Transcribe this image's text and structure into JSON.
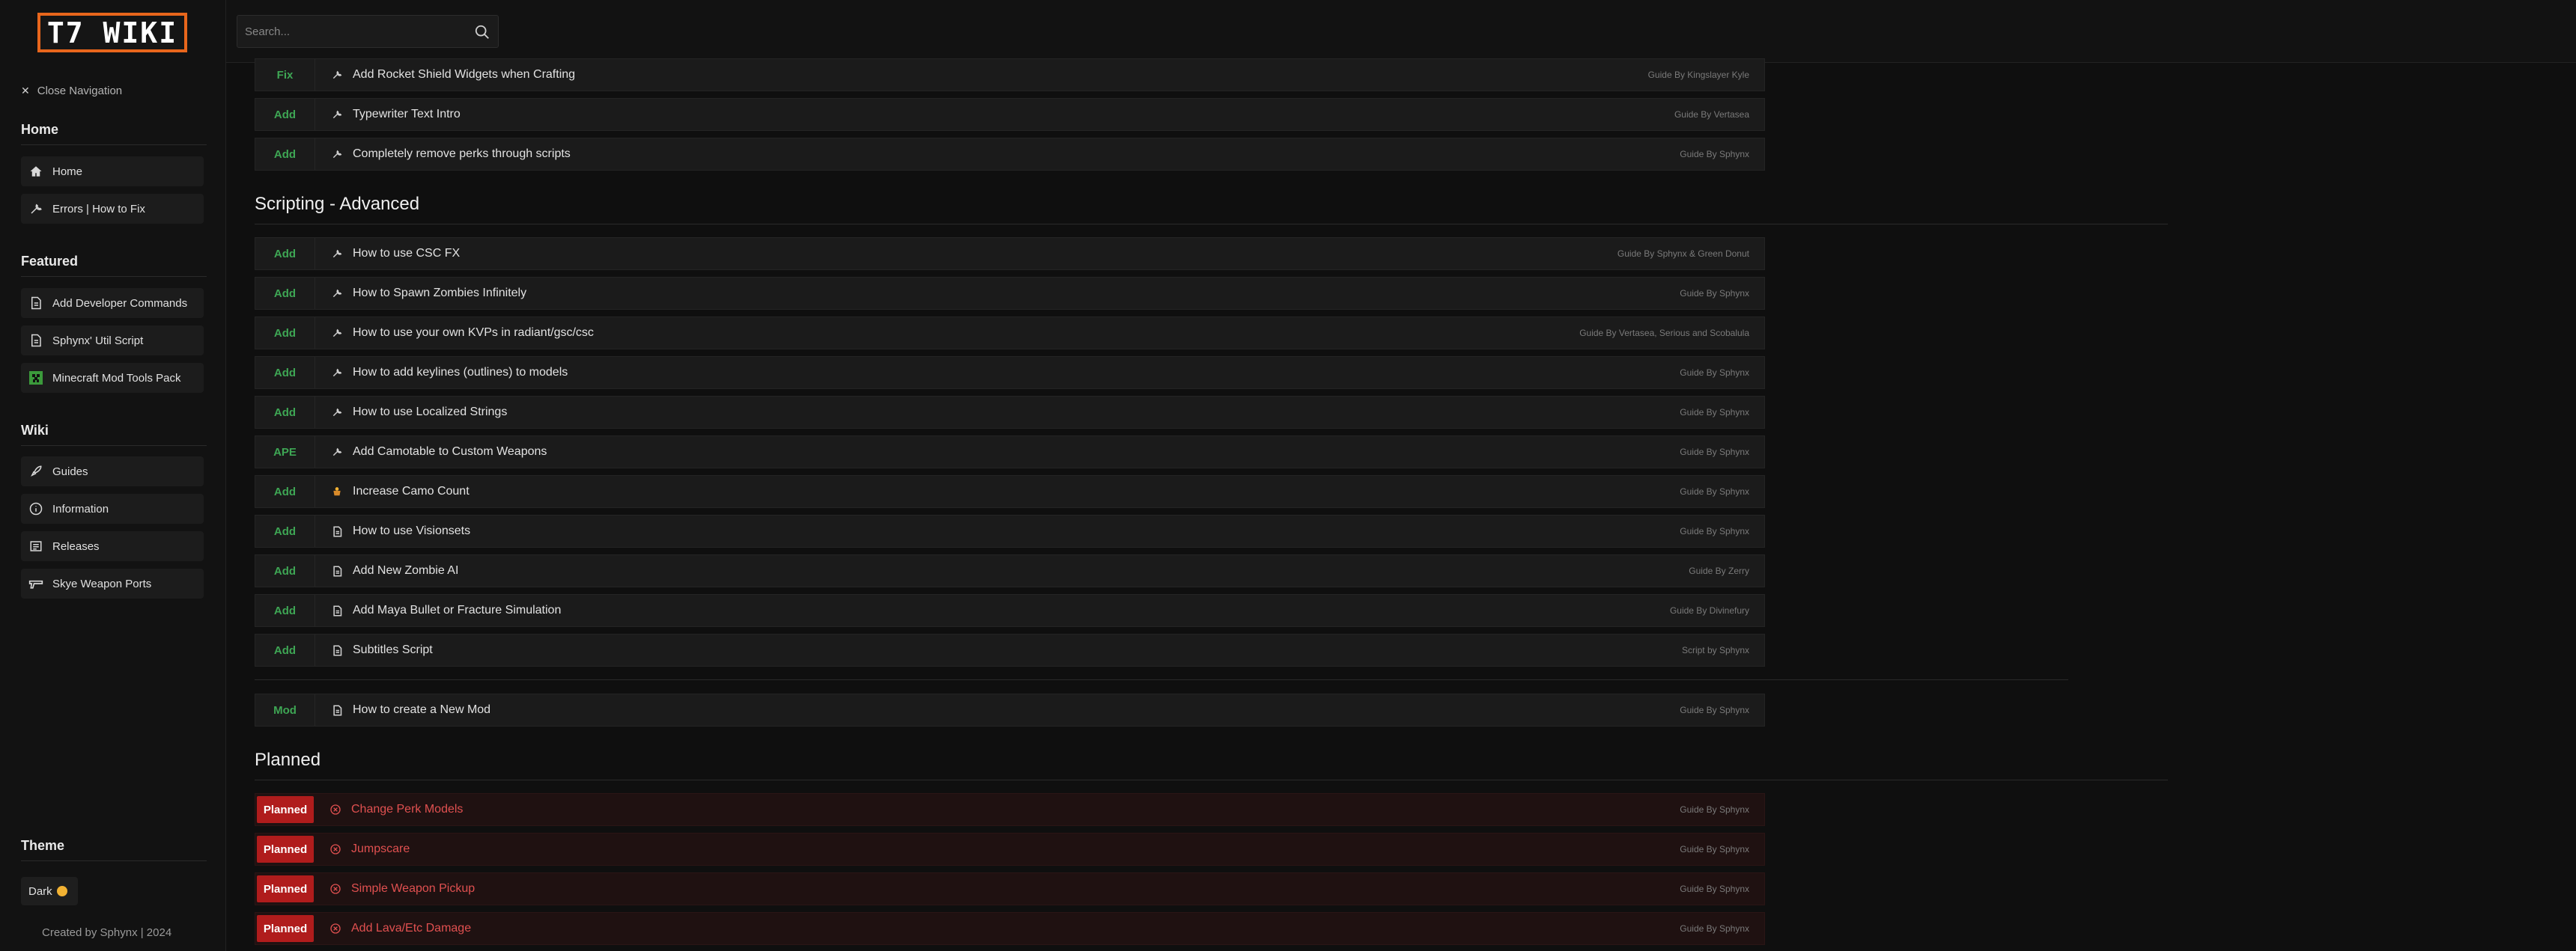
{
  "logo": {
    "text": "T7 WIKI",
    "color": "#e8661c"
  },
  "sidebar": {
    "close_label": "Close Navigation",
    "sections": [
      {
        "title": "Home",
        "items": [
          {
            "label": "Home",
            "icon": "home-icon"
          },
          {
            "label": "Errors | How to Fix",
            "icon": "wrench-icon"
          }
        ]
      },
      {
        "title": "Featured",
        "items": [
          {
            "label": "Add Developer Commands",
            "icon": "document-icon"
          },
          {
            "label": "Sphynx' Util Script",
            "icon": "document-icon"
          },
          {
            "label": "Minecraft Mod Tools Pack",
            "icon": "minecraft-icon"
          }
        ]
      },
      {
        "title": "Wiki",
        "items": [
          {
            "label": "Guides",
            "icon": "rocket-icon"
          },
          {
            "label": "Information",
            "icon": "info-icon"
          },
          {
            "label": "Releases",
            "icon": "releases-icon"
          },
          {
            "label": "Skye Weapon Ports",
            "icon": "gun-icon"
          }
        ]
      }
    ],
    "theme_title": "Theme",
    "theme_value": "Dark",
    "credit": "Created by Sphynx | 2024"
  },
  "search": {
    "placeholder": "Search..."
  },
  "colors": {
    "accent_green": "#3ea654",
    "planned_red": "#b01c1c",
    "planned_text": "#e05050"
  },
  "top_rows": [
    {
      "tag": "Fix",
      "icon": "wrench-icon",
      "title": "Add Rocket Shield Widgets when Crafting",
      "by": "Guide By Kingslayer Kyle"
    },
    {
      "tag": "Add",
      "icon": "wrench-icon",
      "title": "Typewriter Text Intro",
      "by": "Guide By Vertasea"
    },
    {
      "tag": "Add",
      "icon": "wrench-icon",
      "title": "Completely remove perks through scripts",
      "by": "Guide By Sphynx"
    }
  ],
  "advanced": {
    "heading": "Scripting - Advanced",
    "rows": [
      {
        "tag": "Add",
        "icon": "wrench-icon",
        "title": "How to use CSC FX",
        "by": "Guide By Sphynx & Green Donut"
      },
      {
        "tag": "Add",
        "icon": "wrench-icon",
        "title": "How to Spawn Zombies Infinitely",
        "by": "Guide By Sphynx"
      },
      {
        "tag": "Add",
        "icon": "wrench-icon",
        "title": "How to use your own KVPs in radiant/gsc/csc",
        "by": "Guide By Vertasea, Serious and Scobalula"
      },
      {
        "tag": "Add",
        "icon": "wrench-icon",
        "title": "How to add keylines (outlines) to models",
        "by": "Guide By Sphynx"
      },
      {
        "tag": "Add",
        "icon": "wrench-icon",
        "title": "How to use Localized Strings",
        "by": "Guide By Sphynx"
      },
      {
        "tag": "APE",
        "icon": "wrench-icon",
        "title": "Add Camotable to Custom Weapons",
        "by": "Guide By Sphynx"
      },
      {
        "tag": "Add",
        "icon": "camo-icon",
        "title": "Increase Camo Count",
        "by": "Guide By Sphynx"
      },
      {
        "tag": "Add",
        "icon": "document-icon",
        "title": "How to use Visionsets",
        "by": "Guide By Sphynx"
      },
      {
        "tag": "Add",
        "icon": "document-icon",
        "title": "Add New Zombie AI",
        "by": "Guide By Zerry"
      },
      {
        "tag": "Add",
        "icon": "document-icon",
        "title": "Add Maya Bullet or Fracture Simulation",
        "by": "Guide By Divinefury"
      },
      {
        "tag": "Add",
        "icon": "document-icon",
        "title": "Subtitles Script",
        "by": "Script by Sphynx"
      }
    ]
  },
  "mod_row": {
    "tag": "Mod",
    "icon": "document-icon",
    "title": "How to create a New Mod",
    "by": "Guide By Sphynx"
  },
  "planned": {
    "heading": "Planned",
    "rows": [
      {
        "tag": "Planned",
        "icon": "x-circle-icon",
        "title": "Change Perk Models",
        "by": "Guide By Sphynx"
      },
      {
        "tag": "Planned",
        "icon": "x-circle-icon",
        "title": "Jumpscare",
        "by": "Guide By Sphynx"
      },
      {
        "tag": "Planned",
        "icon": "x-circle-icon",
        "title": "Simple Weapon Pickup",
        "by": "Guide By Sphynx"
      },
      {
        "tag": "Planned",
        "icon": "x-circle-icon",
        "title": "Add Lava/Etc Damage",
        "by": "Guide By Sphynx"
      }
    ]
  }
}
